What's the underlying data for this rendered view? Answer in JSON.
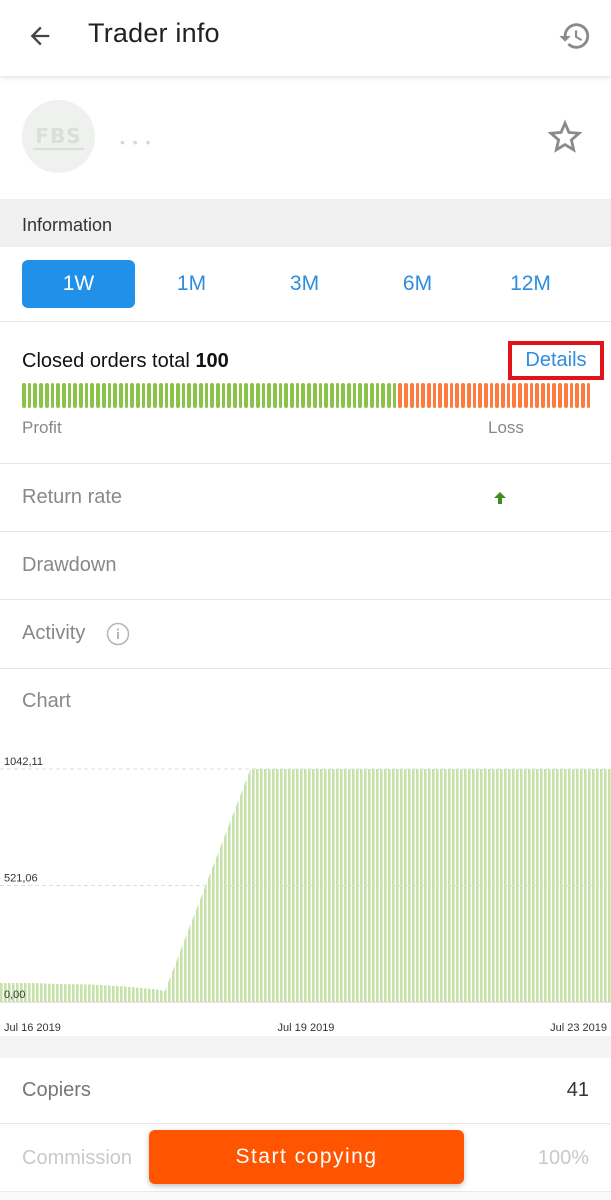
{
  "header": {
    "title": "Trader info"
  },
  "trader": {
    "logo_text": "FBS",
    "name": "• • •"
  },
  "information": {
    "section_label": "Information",
    "tabs": [
      {
        "label": "1W",
        "active": true
      },
      {
        "label": "1M",
        "active": false
      },
      {
        "label": "3M",
        "active": false
      },
      {
        "label": "6M",
        "active": false
      },
      {
        "label": "12M",
        "active": false
      }
    ]
  },
  "closed_orders": {
    "label": "Closed orders total",
    "total": "100",
    "details_label": "Details",
    "profit_label": "Profit",
    "loss_label": "Loss",
    "profit_count": 66,
    "loss_count": 34,
    "profit_color": "#8bc34a",
    "loss_color": "#ff7a3d"
  },
  "stats": {
    "return_rate_label": "Return rate",
    "drawdown_label": "Drawdown",
    "activity_label": "Activity"
  },
  "chart_section": {
    "label": "Chart"
  },
  "chart_data": {
    "type": "area",
    "title": "",
    "xlabel": "",
    "ylabel": "",
    "x_tick_labels": [
      "Jul 16 2019",
      "Jul 19 2019",
      "Jul 23 2019"
    ],
    "y_tick_labels": [
      "0,00",
      "521,06",
      "1042,11"
    ],
    "y_ticks": [
      0,
      521.06,
      1042.11
    ],
    "ylim": [
      0,
      1042.11
    ],
    "x": [
      0,
      0.05,
      0.1,
      0.15,
      0.2,
      0.25,
      0.27,
      0.41,
      0.45,
      0.5,
      0.6,
      0.7,
      0.8,
      0.9,
      1.0
    ],
    "values": [
      85,
      85,
      80,
      78,
      70,
      58,
      50,
      1042.11,
      1042.11,
      1042.11,
      1042.11,
      1042.11,
      1042.11,
      1042.11,
      1042.11
    ],
    "color": "#c5e3a6",
    "grid": "horizontal dashed"
  },
  "bottom": {
    "copiers_label": "Copiers",
    "copiers_value": "41",
    "commission_label": "Commission",
    "commission_value": "100%",
    "start_label": "Start copying"
  }
}
